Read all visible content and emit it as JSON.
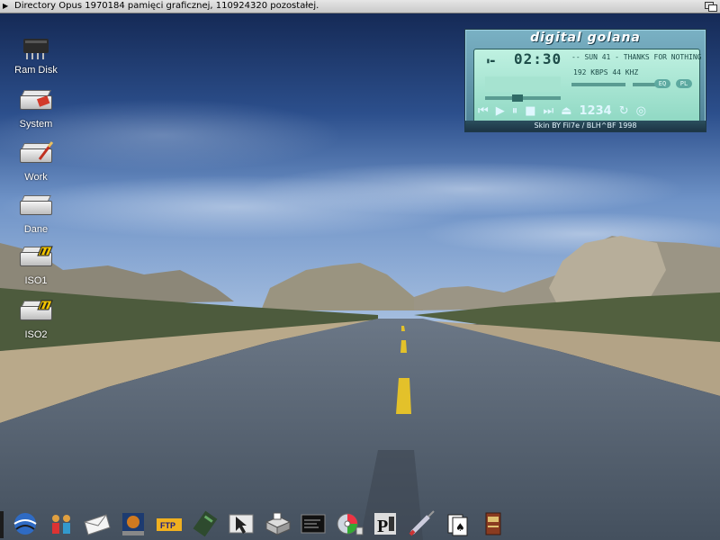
{
  "window": {
    "title": "Directory Opus  1970184 pamięci graficznej, 110924320 pozostałej."
  },
  "desktop_icons": [
    {
      "label": "Ram Disk",
      "icon": "ram-chip-icon"
    },
    {
      "label": "System",
      "icon": "hard-drive-icon"
    },
    {
      "label": "Work",
      "icon": "hard-drive-icon"
    },
    {
      "label": "Dane",
      "icon": "hard-drive-icon"
    },
    {
      "label": "ISO1",
      "icon": "cd-drive-icon"
    },
    {
      "label": "ISO2",
      "icon": "cd-drive-icon"
    }
  ],
  "player": {
    "logo": "digital golana",
    "time": "02:30",
    "state": "▮▬",
    "song": "-- SUN 41 - THANKS FOR NOTHING",
    "bitrate": "192 KBPS  44 KHZ",
    "eq_label": "EQ",
    "pl_label": "PL",
    "track_label": "1234",
    "credit": "Skin BY Fil7e / BLH^BF 1998"
  },
  "dock_icons": [
    "globe-icon",
    "people-icon",
    "mail-icon",
    "browser-icon",
    "ftp-icon",
    "chip-icon",
    "cursor-icon",
    "printer-icon",
    "terminal-icon",
    "cd-player-icon",
    "paint-icon",
    "syringe-icon",
    "cards-icon",
    "book-icon"
  ],
  "colors": {
    "sky_top": "#17305f",
    "sky_mid": "#4c79b7",
    "road": "#5f6a78",
    "road_line": "#e3c12a",
    "player_skin": "#6aa3b8",
    "player_lcd": "#aeeadb"
  }
}
